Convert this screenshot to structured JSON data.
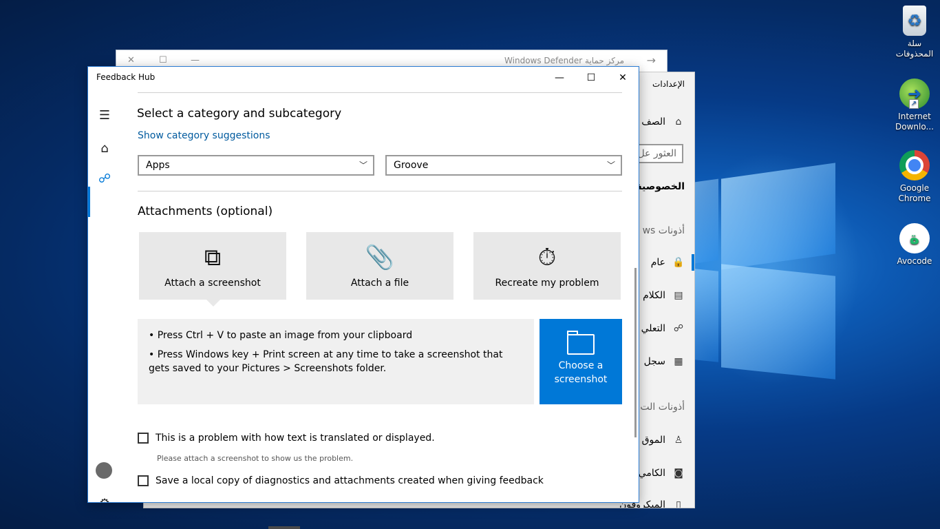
{
  "desktop": {
    "icons": [
      {
        "label": "سلة المحذوفات",
        "icon": "recycle-bin-icon"
      },
      {
        "label": "Internet Downlo...",
        "icon": "idm-icon"
      },
      {
        "label": "Google Chrome",
        "icon": "chrome-icon"
      },
      {
        "label": "Avocode",
        "icon": "avocode-icon"
      }
    ]
  },
  "defender_window": {
    "title": "مركز حماية Windows Defender"
  },
  "settings_window": {
    "title": "الإعدادات",
    "home": "الصف",
    "search_placeholder": "العثور عل",
    "privacy": "الخصوصية",
    "section1": "أذونات ws",
    "items": [
      "عام",
      "الكلام",
      "التعلي",
      "سجل"
    ],
    "section2": "أذونات الت",
    "items2": [
      "الموق",
      "الكامي",
      "الميكروفون"
    ]
  },
  "feedback_hub": {
    "title": "Feedback Hub",
    "category_heading": "Select a category and subcategory",
    "show_suggestions": "Show category suggestions",
    "category_value": "Apps",
    "subcategory_value": "Groove",
    "attachments_heading": "Attachments (optional)",
    "tiles": [
      {
        "label": "Attach a screenshot",
        "icon": "screenshot-icon"
      },
      {
        "label": "Attach a file",
        "icon": "paperclip-icon"
      },
      {
        "label": "Recreate my problem",
        "icon": "stopwatch-icon"
      }
    ],
    "tips": [
      "• Press Ctrl + V to paste an image from your clipboard",
      "• Press Windows key + Print screen at any time to take a screenshot that gets saved to your Pictures > Screenshots folder."
    ],
    "choose_button": "Choose a screenshot",
    "checkbox1": "This is a problem with how text is translated or displayed.",
    "checkbox1_hint": "Please attach a screenshot to show us the problem.",
    "checkbox2": "Save a local copy of diagnostics and attachments created when giving feedback"
  }
}
